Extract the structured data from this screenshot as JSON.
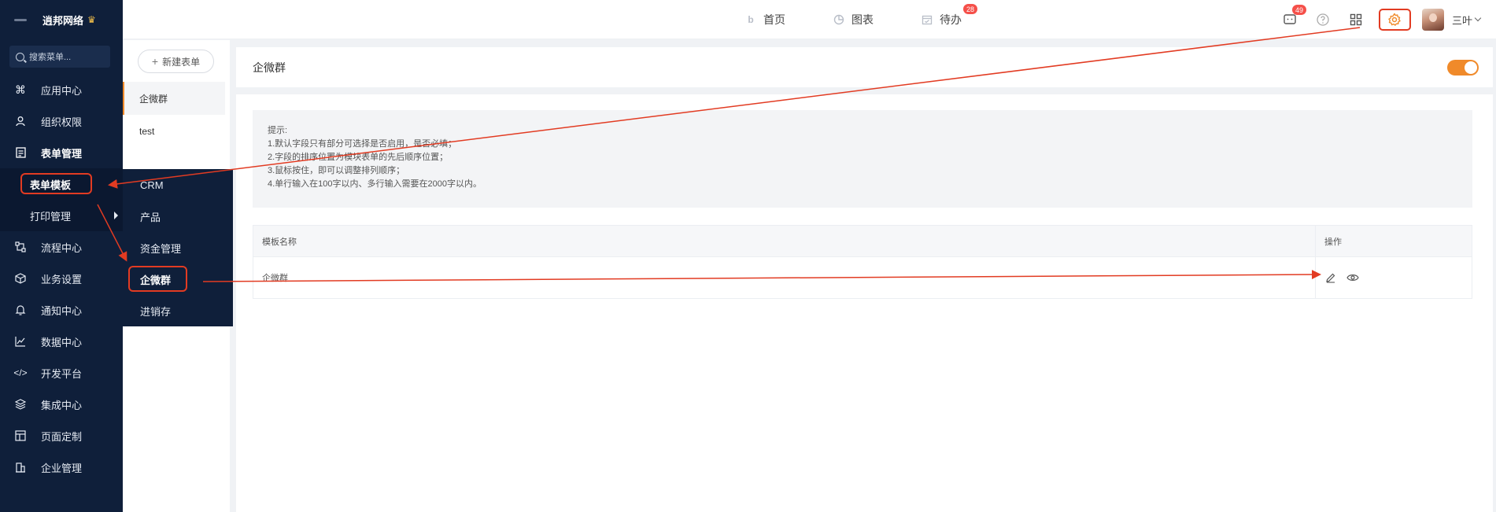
{
  "sidebar": {
    "brand": "逍邦网络",
    "search_placeholder": "搜索菜单...",
    "items": [
      {
        "label": "应用中心",
        "icon": "command-icon"
      },
      {
        "label": "组织权限",
        "icon": "user-icon"
      },
      {
        "label": "表单管理",
        "icon": "form-icon"
      }
    ],
    "sub_items": [
      {
        "label": "表单模板"
      },
      {
        "label": "打印管理"
      }
    ],
    "items_after": [
      {
        "label": "流程中心",
        "icon": "flow-icon"
      },
      {
        "label": "业务设置",
        "icon": "cube-icon"
      },
      {
        "label": "通知中心",
        "icon": "bell-icon"
      },
      {
        "label": "数据中心",
        "icon": "chart-icon"
      },
      {
        "label": "开发平台",
        "icon": "code-icon"
      },
      {
        "label": "集成中心",
        "icon": "layers-icon"
      },
      {
        "label": "页面定制",
        "icon": "layout-icon"
      },
      {
        "label": "企业管理",
        "icon": "building-icon"
      }
    ]
  },
  "flyout": {
    "items": [
      {
        "label": "CRM"
      },
      {
        "label": "产品"
      },
      {
        "label": "资金管理"
      },
      {
        "label": "企微群"
      },
      {
        "label": "进销存"
      }
    ]
  },
  "header": {
    "nav": [
      {
        "label": "首页",
        "icon": "b-logo-icon",
        "badge": ""
      },
      {
        "label": "图表",
        "icon": "pie-icon",
        "badge": ""
      },
      {
        "label": "待办",
        "icon": "calendar-icon",
        "badge": "28"
      }
    ],
    "message_badge": "49",
    "username": "三叶"
  },
  "formlist": {
    "new_button": "新建表单",
    "items": [
      {
        "label": "企微群"
      },
      {
        "label": "test"
      }
    ]
  },
  "main": {
    "title": "企微群",
    "toggle_on": true,
    "tips": [
      "提示:",
      "1.默认字段只有部分可选择是否启用，是否必填；",
      "2.字段的排序位置为模块表单的先后顺序位置；",
      "3.鼠标按住，即可以调整排列顺序；",
      "4.单行输入在100字以内、多行输入需要在2000字以内。"
    ],
    "table": {
      "headers": [
        "模板名称",
        "操作"
      ],
      "rows": [
        {
          "name": "企微群"
        }
      ]
    }
  },
  "colors": {
    "sidebar_bg": "#0f1f3a",
    "accent": "#f08a2a",
    "annotation": "#e23b22",
    "badge": "#f5504a"
  }
}
